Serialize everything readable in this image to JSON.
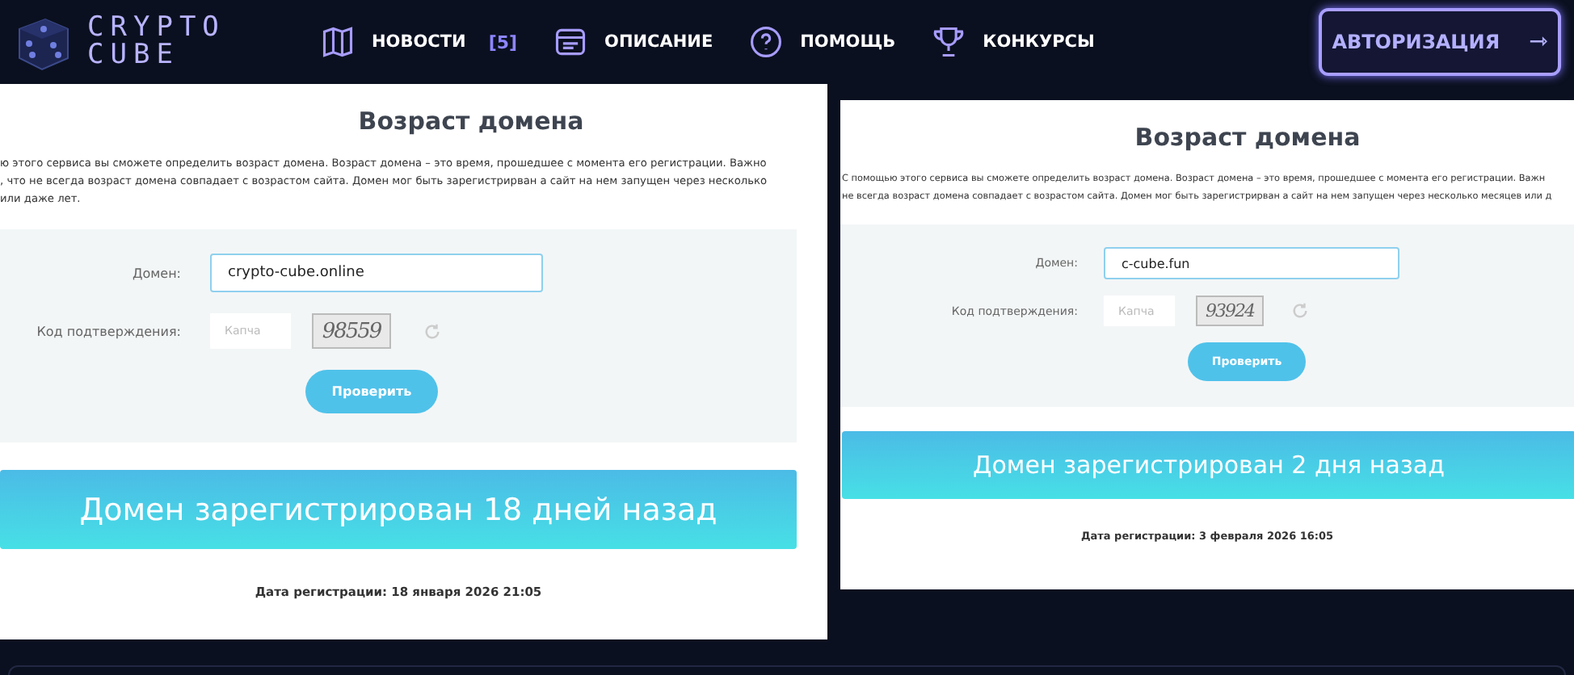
{
  "header": {
    "logo": [
      "CRYPTO",
      "CUBE"
    ],
    "nav": [
      {
        "kind": "map",
        "label": "НОВОСТИ",
        "badge": "[5]"
      },
      {
        "kind": "doc",
        "label": "ОПИСАНИЕ"
      },
      {
        "kind": "help",
        "label": "ПОМОЩЬ"
      },
      {
        "kind": "cup",
        "label": "КОНКУРСЫ"
      }
    ],
    "login": {
      "label": "АВТОРИЗАЦИЯ",
      "arrow": "⇾"
    }
  },
  "panels": [
    {
      "title": "Возраст домена",
      "description": [
        "ю этого сервиса вы сможете определить возраст домена. Возраст домена – это время, прошедшее с момента его регистрации. Важно",
        ", что не всегда возраст домена совпадает с возрастом сайта. Домен мог быть зарегистрирван а сайт на нем запущен через несколько",
        "или даже лет."
      ],
      "domain_label": "Домен:",
      "domain_value": "crypto-cube.online",
      "code_label": "Код подтверждения:",
      "captcha_placeholder": "Капча",
      "captcha_text": "98559",
      "button": "Проверить",
      "result": "Домен зарегистрирован 18 дней назад",
      "date": "Дата регистрации: 18 января 2026 21:05"
    },
    {
      "title": "Возраст домена",
      "description": [
        "С помощью этого сервиса вы сможете определить возраст домена. Возраст домена – это время, прошедшее с момента его регистрации. Важн",
        "не всегда возраст домена совпадает с возрастом сайта. Домен мог быть зарегистрирван а сайт на нем запущен через несколько месяцев или д"
      ],
      "domain_label": "Домен:",
      "domain_value": "c-cube.fun",
      "code_label": "Код подтверждения:",
      "captcha_placeholder": "Капча",
      "captcha_text": "93924",
      "button": "Проверить",
      "result": "Домен зарегистрирован 2 дня назад",
      "date": "Дата регистрации: 3 февраля 2026 16:05"
    }
  ]
}
